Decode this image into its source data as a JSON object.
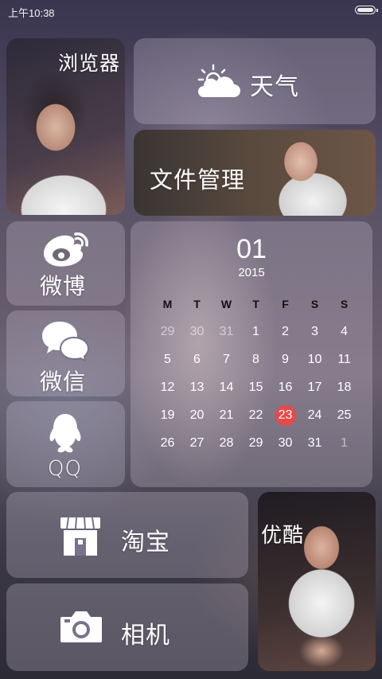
{
  "status": {
    "time": "上午10:38"
  },
  "tiles": {
    "browser": "浏览器",
    "weather": "天气",
    "files": "文件管理",
    "weibo": "微博",
    "wechat": "微信",
    "qq": "QQ",
    "taobao": "淘宝",
    "youku": "优酷",
    "camera": "相机"
  },
  "calendar": {
    "month": "01",
    "year": "2015",
    "weekdays": [
      "M",
      "T",
      "W",
      "T",
      "F",
      "S",
      "S"
    ],
    "weeks": [
      [
        "29",
        "30",
        "31",
        "1",
        "2",
        "3",
        "4"
      ],
      [
        "5",
        "6",
        "7",
        "8",
        "9",
        "10",
        "11"
      ],
      [
        "12",
        "13",
        "14",
        "15",
        "16",
        "17",
        "18"
      ],
      [
        "19",
        "20",
        "21",
        "22",
        "23",
        "24",
        "25"
      ],
      [
        "26",
        "27",
        "28",
        "29",
        "30",
        "31",
        "1"
      ]
    ],
    "today": "23"
  },
  "icons": {
    "weather": "partly-cloudy-icon",
    "weibo": "weibo-icon",
    "wechat": "wechat-icon",
    "qq": "qq-penguin-icon",
    "taobao": "store-icon",
    "camera": "camera-icon"
  }
}
